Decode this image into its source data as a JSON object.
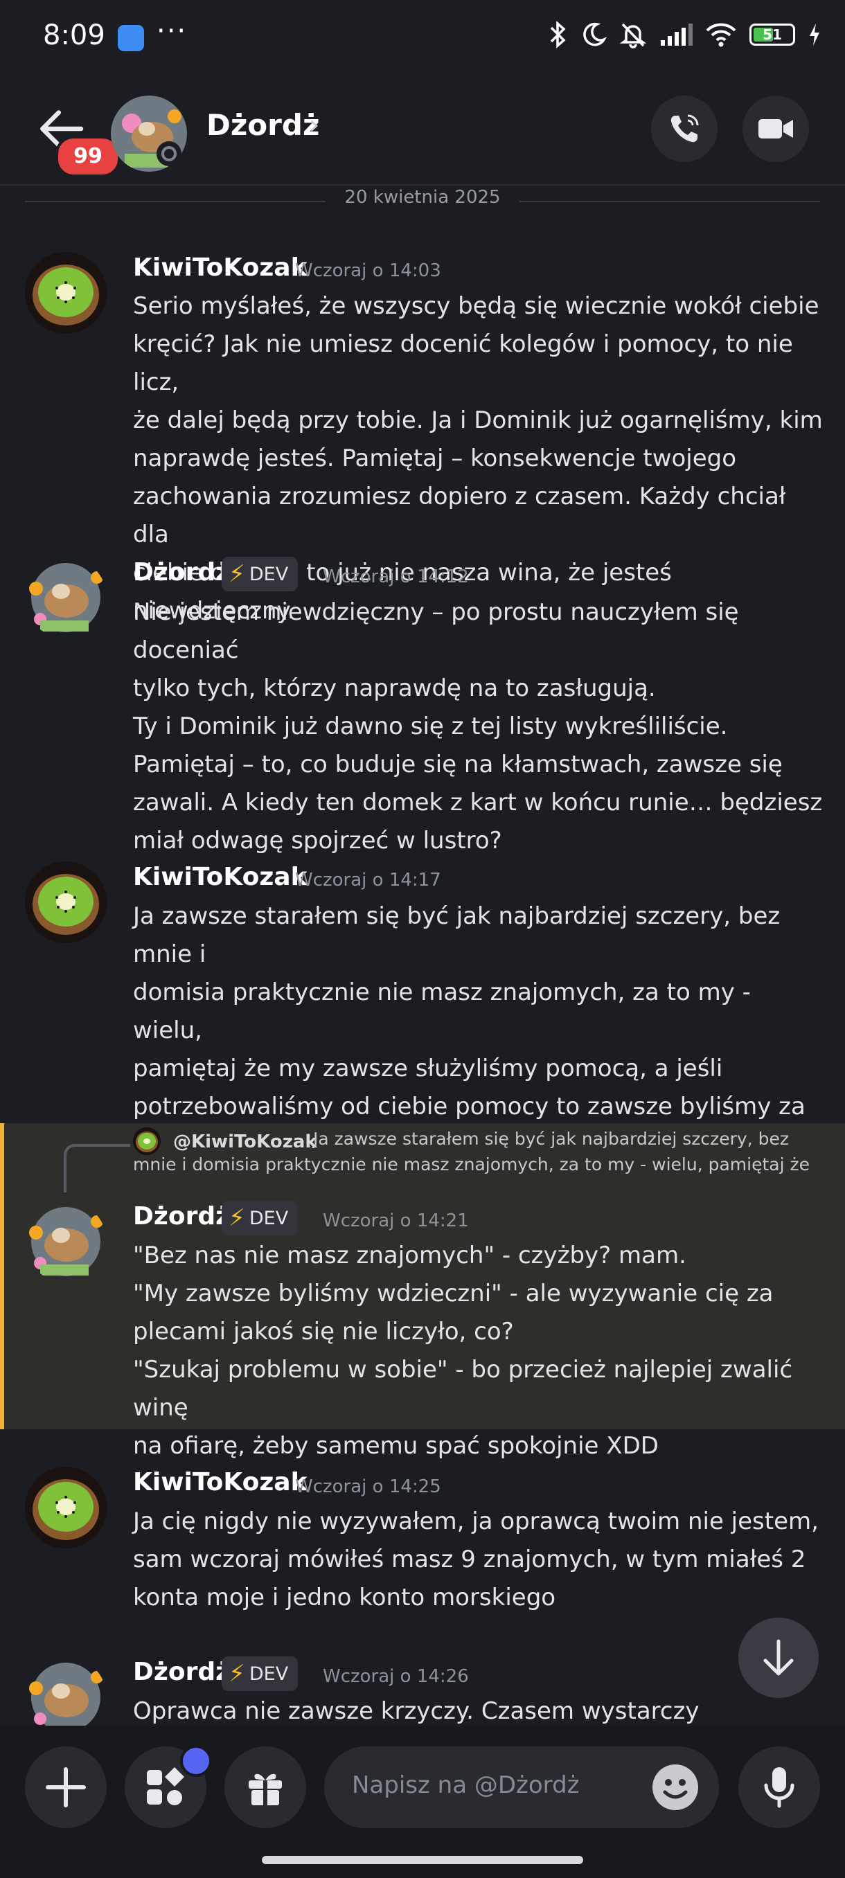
{
  "status_bar": {
    "time": "8:09",
    "more": "···",
    "battery": "51"
  },
  "header": {
    "unread_badge": "99",
    "contact_name": "Dżordż",
    "chevron": "›"
  },
  "date_divider": "20 kwietnia 2025",
  "dev_tag": "DEV",
  "messages": [
    {
      "author": "KiwiToKozak",
      "time": "Wczoraj o 14:03",
      "text": "Serio myślałeś, że wszyscy będą się wiecznie wokół ciebie\nkręcić? Jak nie umiesz docenić kolegów i pomocy, to nie licz,\nże dalej będą przy tobie. Ja i Dominik już ogarnęliśmy, kim\nnaprawdę jesteś. Pamiętaj – konsekwencje twojego\nzachowania zrozumiesz dopiero z czasem. Każdy chciał dla\nciebie dobrze, to już nie nasza wina, że jesteś niewdzięczny."
    },
    {
      "author": "Dżordż",
      "time": "Wczoraj o 14:12",
      "text": "Nie jestem niewdzięczny – po prostu nauczyłem się doceniać\ntylko tych, którzy naprawdę na to zasługują.\nTy i Dominik już dawno się z tej listy wykreśliliście.\nPamiętaj – to, co buduje się na kłamstwach, zawsze się\nzawali. A kiedy ten domek z kart w końcu runie… będziesz\nmiał odwagę spojrzeć w lustro?"
    },
    {
      "author": "KiwiToKozak",
      "time": "Wczoraj o 14:17",
      "text": "Ja zawsze starałem się być jak najbardziej szczery, bez mnie i\ndomisia praktycznie nie masz znajomych, za to my - wielu,\npamiętaj że my zawsze służyliśmy pomocą, a jeśli\npotrzebowaliśmy od ciebie pomocy to zawsze byliśmy za nią\nwdzięczni, więc nie szukaj problemów w innych, tylko w sobie"
    },
    {
      "author": "Dżordż",
      "time": "Wczoraj o 14:21",
      "reply_user": "@KiwiToKozak",
      "reply_text": "Ja zawsze starałem się być jak najbardziej szczery, bez\nmnie i domisia praktycznie nie masz znajomych, za to my - wielu, pamiętaj że",
      "text": "\"Bez nas nie masz znajomych\" - czyżby? mam.\n\"My zawsze byliśmy wdzieczni\" - ale wyzywanie cię za\nplecami jakoś się nie liczyło, co?\n\"Szukaj problemu w sobie\" - bo przecież najlepiej zwalić winę\nna ofiarę, żeby samemu spać spokojnie XDD"
    },
    {
      "author": "KiwiToKozak",
      "time": "Wczoraj o 14:25",
      "text": "Ja cię nigdy nie wyzywałem, ja oprawcą twoim nie jestem,\nsam wczoraj mówiłeś masz 9 znajomych, w tym miałeś 2\nkonta moje i jedno konto morskiego"
    },
    {
      "author": "Dżordż",
      "time": "Wczoraj o 14:26",
      "text": "Oprawca nie zawsze krzyczy. Czasem wystarczy obojętność i"
    }
  ],
  "composer": {
    "placeholder": "Napisz na @Dżordż"
  },
  "colors": {
    "background": "#1c1d22",
    "badge_red": "#e84141",
    "highlight_bar": "#f0b232",
    "nitro_dot": "#5865f2"
  }
}
